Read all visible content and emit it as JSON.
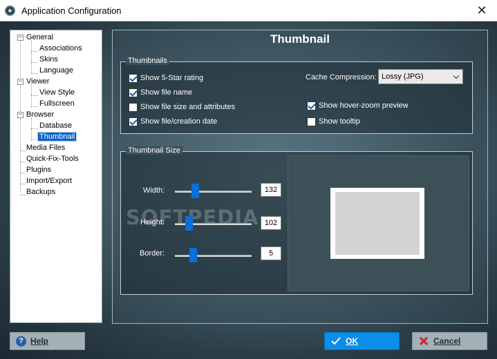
{
  "window": {
    "title": "Application Configuration",
    "close_glyph": "✕"
  },
  "tree": {
    "items": [
      {
        "label": "General",
        "expander": "−"
      },
      {
        "label": "Associations"
      },
      {
        "label": "Skins"
      },
      {
        "label": "Language"
      },
      {
        "label": "Viewer",
        "expander": "−"
      },
      {
        "label": "View Style"
      },
      {
        "label": "Fullscreen"
      },
      {
        "label": "Browser",
        "expander": "−"
      },
      {
        "label": "Database"
      },
      {
        "label": "Thumbnail",
        "selected": true
      },
      {
        "label": "Media Files"
      },
      {
        "label": "Quick-Fix-Tools"
      },
      {
        "label": "Plugins"
      },
      {
        "label": "Import/Export"
      },
      {
        "label": "Backups"
      }
    ]
  },
  "panel": {
    "title": "Thumbnail",
    "thumbnails_group": {
      "title": "Thumbnails",
      "checkboxes": [
        {
          "label": "Show 5-Star rating",
          "checked": true
        },
        {
          "label": "Show file name",
          "checked": true
        },
        {
          "label": "Show file size and attributes",
          "checked": false
        },
        {
          "label": "Show file/creation date",
          "checked": true
        },
        {
          "label": "Show hover-zoom preview",
          "checked": true
        },
        {
          "label": "Show tooltip",
          "checked": false
        }
      ],
      "cache_compression_label": "Cache Compression:",
      "cache_compression_value": "Lossy (JPG)"
    },
    "size_group": {
      "title": "Thumbnail Size",
      "width_label": "Width:",
      "width_value": "132",
      "height_label": "Height:",
      "height_value": "102",
      "border_label": "Border:",
      "border_value": "5"
    },
    "watermark": "SOFTPEDIA"
  },
  "buttons": {
    "help_label": "Help",
    "ok_label": "OK",
    "cancel_label": "Cancel"
  },
  "colors": {
    "accent": "#0a8ee8",
    "selection": "#0b63c6",
    "slider_thumb": "#0a6fd8"
  }
}
